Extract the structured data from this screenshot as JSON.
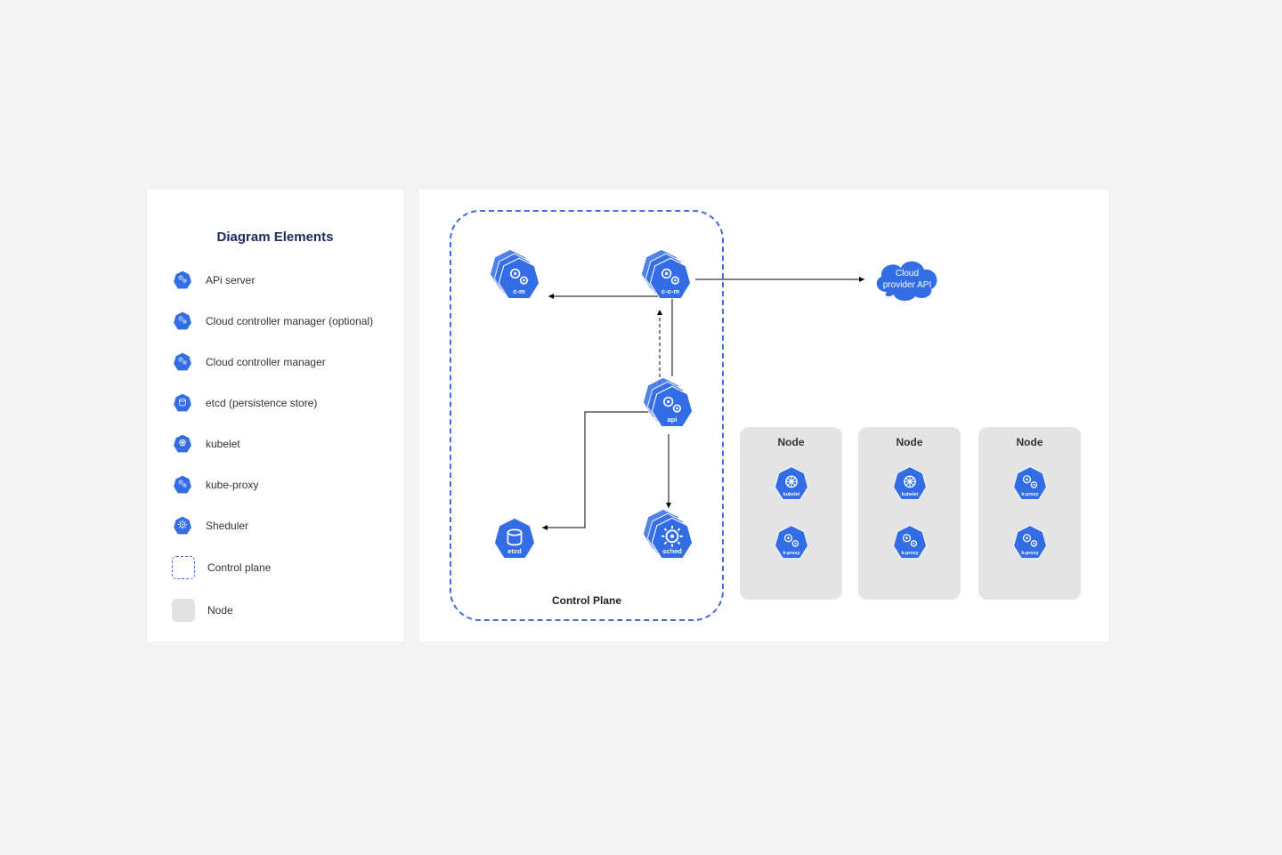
{
  "legend": {
    "title": "Diagram Elements",
    "items": [
      {
        "label": "APi server"
      },
      {
        "label": "Cloud controller manager (optional)"
      },
      {
        "label": "Cloud controller manager"
      },
      {
        "label": "etcd (persistence store)"
      },
      {
        "label": "kubelet"
      },
      {
        "label": "kube-proxy"
      },
      {
        "label": "Sheduler"
      },
      {
        "label": "Control plane"
      },
      {
        "label": "Node"
      }
    ]
  },
  "diagram": {
    "control_plane_label": "Control Plane",
    "cloud_label_1": "Cloud",
    "cloud_label_2": "provider API",
    "components": {
      "cm": "c-m",
      "ccm": "c-c-m",
      "api": "api",
      "etcd": "etcd",
      "sched": "sched",
      "kubelet": "kubelet",
      "kproxy": "k-proxy"
    },
    "nodes": [
      {
        "title": "Node"
      },
      {
        "title": "Node"
      },
      {
        "title": "Node"
      }
    ]
  }
}
